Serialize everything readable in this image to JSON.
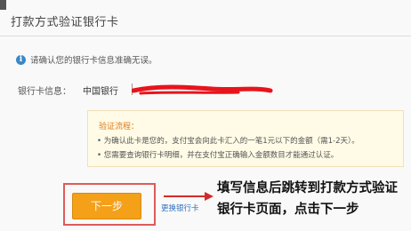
{
  "header": {
    "title": "打款方式验证银行卡"
  },
  "notice": {
    "text": "请确认您的银行卡信息准确无误。"
  },
  "bank": {
    "label": "银行卡信息：",
    "name": "中国银行"
  },
  "steps": {
    "title": "验证流程：",
    "items": [
      "• 为确认此卡是您的，支付宝会向此卡汇入的一笔1元以下的金额（需1-2天）。",
      "• 您需要查询银行卡明细，并在支付宝正确输入金额数目才能通过认证。"
    ]
  },
  "actions": {
    "next_label": "下一步",
    "change_card_label": "更换银行卡"
  },
  "annotation": {
    "line1": "填写信息后跳转到打款方式验证",
    "line2": "银行卡页面，点击下一步"
  },
  "colors": {
    "accent_orange": "#f5a019",
    "highlight_red": "#e05a5a",
    "link_blue": "#2f6fbf",
    "step_title_orange": "#e07b1a",
    "redaction_red": "#e8141c"
  }
}
